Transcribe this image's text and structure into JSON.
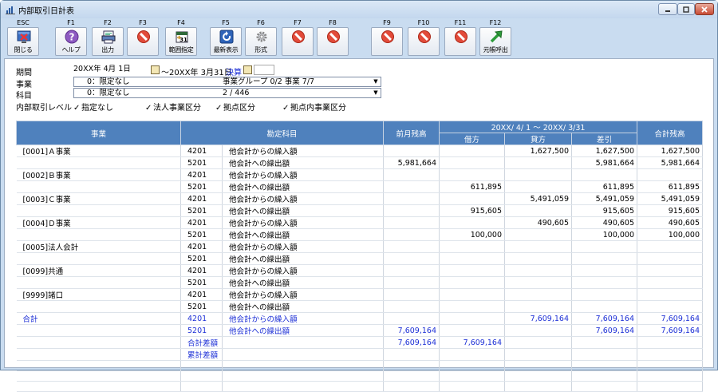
{
  "window": {
    "title": "内部取引日計表"
  },
  "toolbar": {
    "keys": [
      {
        "key": "ESC",
        "label": "閉じる",
        "icon": "close-window-icon"
      },
      {
        "key": "F1",
        "label": "ヘルプ",
        "icon": "help-icon"
      },
      {
        "key": "F2",
        "label": "出力",
        "icon": "output-icon"
      },
      {
        "key": "F3",
        "label": "",
        "icon": "disabled-icon"
      },
      {
        "key": "F4",
        "label": "範囲指定",
        "icon": "calendar-icon"
      },
      {
        "key": "F5",
        "label": "最新表示",
        "icon": "refresh-icon"
      },
      {
        "key": "F6",
        "label": "形式",
        "icon": "gear-icon"
      },
      {
        "key": "F7",
        "label": "",
        "icon": "disabled-icon"
      },
      {
        "key": "F8",
        "label": "",
        "icon": "disabled-icon"
      },
      {
        "key": "F9",
        "label": "",
        "icon": "disabled-icon"
      },
      {
        "key": "F10",
        "label": "",
        "icon": "disabled-icon"
      },
      {
        "key": "F11",
        "label": "",
        "icon": "disabled-icon"
      },
      {
        "key": "F12",
        "label": "元帳呼出",
        "icon": "ledger-arrow-icon"
      }
    ]
  },
  "filters": {
    "period_label": "期間",
    "period_from": "20XX年 4月 1日",
    "period_tilde": "～",
    "period_to": "20XX年 3月31日",
    "period_settle": "決算",
    "business_label": "事業",
    "business_value": "0：限定なし",
    "business_group": "事業グループ 0/2 事業 7/7",
    "account_label": "科目",
    "account_value": "0：限定なし",
    "account_count": "2 / 446",
    "internal_label": "内部取引レベル",
    "chk1": "指定なし",
    "chk2": "法人事業区分",
    "chk3": "拠点区分",
    "chk4": "拠点内事業区分"
  },
  "table": {
    "headers": {
      "business": "事業",
      "account": "勘定科目",
      "prev": "前月残高",
      "period": "20XX/ 4/ 1 ～ 20XX/ 3/31",
      "debit": "借方",
      "credit": "貸方",
      "diff": "差引",
      "total": "合計残高"
    },
    "rows": [
      {
        "biz": "[0001]Ａ事業",
        "code": "4201",
        "name": "他会計からの繰入額",
        "prev": "",
        "debit": "",
        "credit": "1,627,500",
        "diff": "1,627,500",
        "total": "1,627,500"
      },
      {
        "biz": "",
        "code": "5201",
        "name": "他会計への繰出額",
        "prev": "5,981,664",
        "debit": "",
        "credit": "",
        "diff": "5,981,664",
        "total": "5,981,664"
      },
      {
        "biz": "[0002]Ｂ事業",
        "code": "4201",
        "name": "他会計からの繰入額",
        "prev": "",
        "debit": "",
        "credit": "",
        "diff": "",
        "total": ""
      },
      {
        "biz": "",
        "code": "5201",
        "name": "他会計への繰出額",
        "prev": "",
        "debit": "611,895",
        "credit": "",
        "diff": "611,895",
        "total": "611,895"
      },
      {
        "biz": "[0003]Ｃ事業",
        "code": "4201",
        "name": "他会計からの繰入額",
        "prev": "",
        "debit": "",
        "credit": "5,491,059",
        "diff": "5,491,059",
        "total": "5,491,059"
      },
      {
        "biz": "",
        "code": "5201",
        "name": "他会計への繰出額",
        "prev": "",
        "debit": "915,605",
        "credit": "",
        "diff": "915,605",
        "total": "915,605"
      },
      {
        "biz": "[0004]Ｄ事業",
        "code": "4201",
        "name": "他会計からの繰入額",
        "prev": "",
        "debit": "",
        "credit": "490,605",
        "diff": "490,605",
        "total": "490,605"
      },
      {
        "biz": "",
        "code": "5201",
        "name": "他会計への繰出額",
        "prev": "",
        "debit": "100,000",
        "credit": "",
        "diff": "100,000",
        "total": "100,000"
      },
      {
        "biz": "[0005]法人会計",
        "code": "4201",
        "name": "他会計からの繰入額",
        "prev": "",
        "debit": "",
        "credit": "",
        "diff": "",
        "total": ""
      },
      {
        "biz": "",
        "code": "5201",
        "name": "他会計への繰出額",
        "prev": "",
        "debit": "",
        "credit": "",
        "diff": "",
        "total": ""
      },
      {
        "biz": "[0099]共通",
        "code": "4201",
        "name": "他会計からの繰入額",
        "prev": "",
        "debit": "",
        "credit": "",
        "diff": "",
        "total": ""
      },
      {
        "biz": "",
        "code": "5201",
        "name": "他会計への繰出額",
        "prev": "",
        "debit": "",
        "credit": "",
        "diff": "",
        "total": ""
      },
      {
        "biz": "[9999]諸口",
        "code": "4201",
        "name": "他会計からの繰入額",
        "prev": "",
        "debit": "",
        "credit": "",
        "diff": "",
        "total": ""
      },
      {
        "biz": "",
        "code": "5201",
        "name": "他会計への繰出額",
        "prev": "",
        "debit": "",
        "credit": "",
        "diff": "",
        "total": ""
      },
      {
        "biz": "合計",
        "code": "4201",
        "name": "他会計からの繰入額",
        "prev": "",
        "debit": "",
        "credit": "7,609,164",
        "diff": "7,609,164",
        "total": "7,609,164",
        "isTotal": true
      },
      {
        "biz": "",
        "code": "5201",
        "name": "他会計への繰出額",
        "prev": "7,609,164",
        "debit": "",
        "credit": "",
        "diff": "7,609,164",
        "total": "7,609,164",
        "isTotal": true
      },
      {
        "biz": "",
        "code": "合計差額",
        "name": "",
        "prev": "7,609,164",
        "debit": "7,609,164",
        "credit": "",
        "diff": "",
        "total": "",
        "isTotal": true
      },
      {
        "biz": "",
        "code": "累計差額",
        "name": "",
        "prev": "",
        "debit": "",
        "credit": "",
        "diff": "",
        "total": "",
        "isTotal": true
      },
      {
        "biz": "",
        "code": "",
        "name": "",
        "prev": "",
        "debit": "",
        "credit": "",
        "diff": "",
        "total": ""
      },
      {
        "biz": "",
        "code": "",
        "name": "",
        "prev": "",
        "debit": "",
        "credit": "",
        "diff": "",
        "total": ""
      },
      {
        "biz": "",
        "code": "",
        "name": "",
        "prev": "",
        "debit": "",
        "credit": "",
        "diff": "",
        "total": ""
      }
    ]
  }
}
